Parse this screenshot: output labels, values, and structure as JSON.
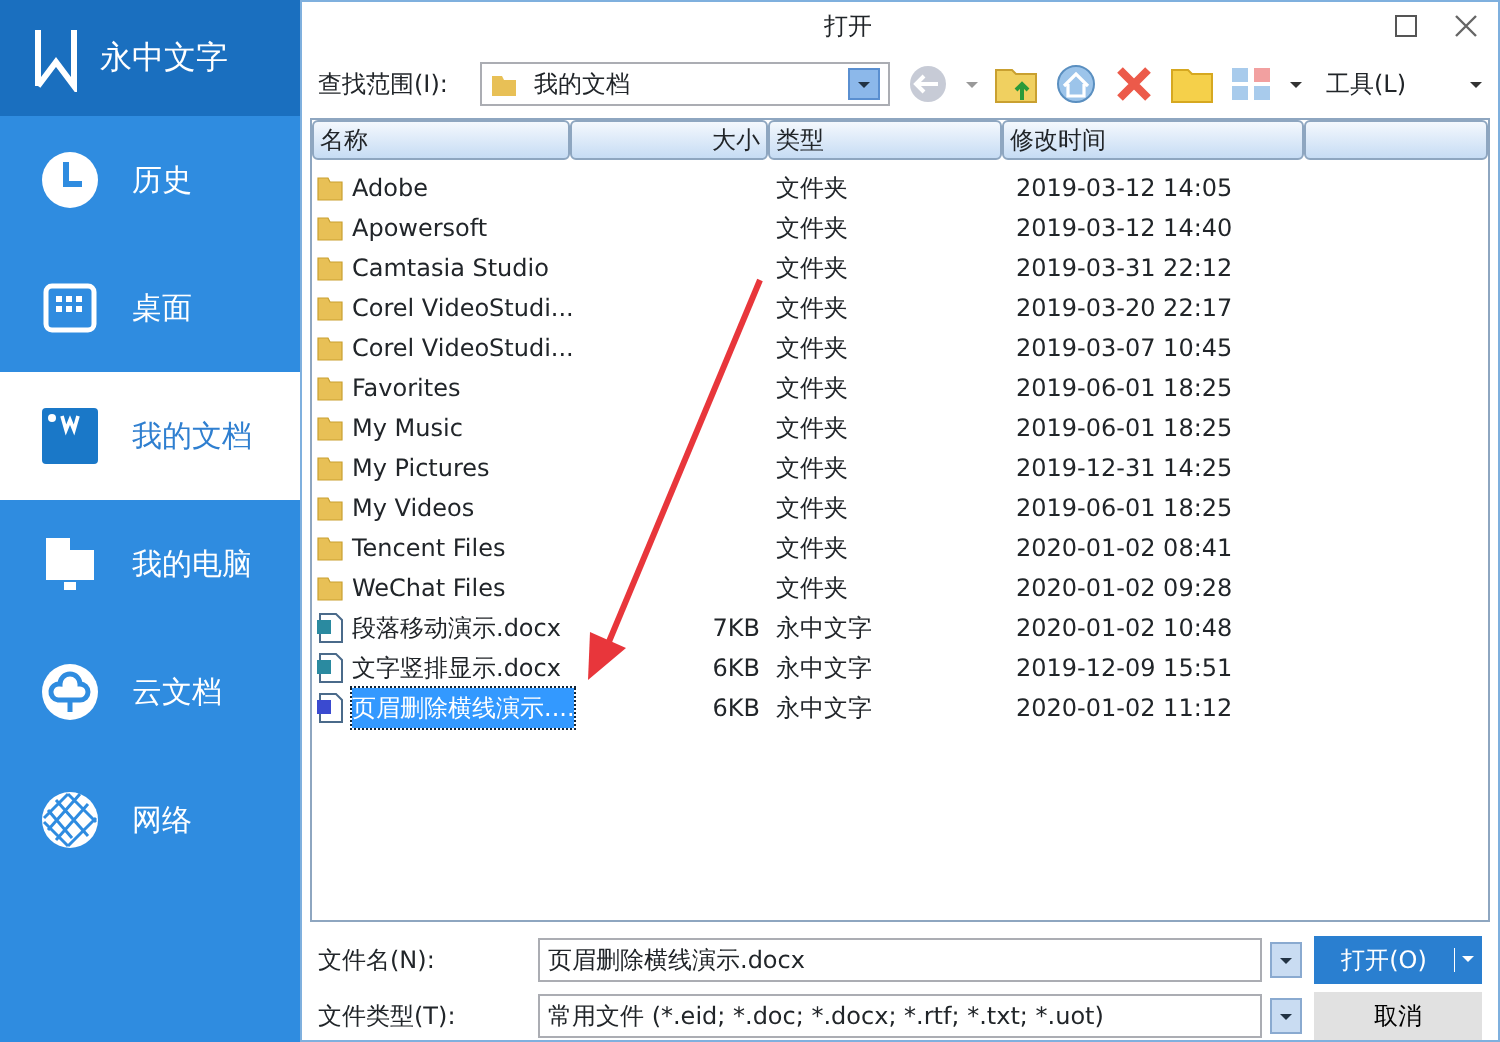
{
  "sidebar": {
    "app_name": "永中文字",
    "items": [
      {
        "kind": "history",
        "label": "历史",
        "selected": false
      },
      {
        "kind": "desktop",
        "label": "桌面",
        "selected": false
      },
      {
        "kind": "documents",
        "label": "我的文档",
        "selected": true
      },
      {
        "kind": "computer",
        "label": "我的电脑",
        "selected": false
      },
      {
        "kind": "cloud",
        "label": "云文档",
        "selected": false
      },
      {
        "kind": "network",
        "label": "网络",
        "selected": false
      }
    ]
  },
  "dialog": {
    "title": "打开",
    "look_in": {
      "label": "查找范围(I):",
      "value": "我的文档"
    },
    "tools": "工具(L)",
    "columns": [
      "名称",
      "大小",
      "类型",
      "修改时间"
    ],
    "files": [
      {
        "kind": "folder",
        "name": "Adobe",
        "type": "文件夹",
        "modified": "2019-03-12 14:05",
        "selected": false
      },
      {
        "kind": "folder",
        "name": "Apowersoft",
        "type": "文件夹",
        "modified": "2019-03-12 14:40",
        "selected": false
      },
      {
        "kind": "folder",
        "name": "Camtasia Studio",
        "type": "文件夹",
        "modified": "2019-03-31 22:12",
        "selected": false
      },
      {
        "kind": "folder",
        "name": "Corel VideoStudi...",
        "type": "文件夹",
        "modified": "2019-03-20 22:17",
        "selected": false
      },
      {
        "kind": "folder",
        "name": "Corel VideoStudi...",
        "type": "文件夹",
        "modified": "2019-03-07 10:45",
        "selected": false
      },
      {
        "kind": "folder",
        "name": "Favorites",
        "type": "文件夹",
        "modified": "2019-06-01 18:25",
        "selected": false
      },
      {
        "kind": "folder",
        "name": "My Music",
        "type": "文件夹",
        "modified": "2019-06-01 18:25",
        "selected": false
      },
      {
        "kind": "folder",
        "name": "My Pictures",
        "type": "文件夹",
        "modified": "2019-12-31 14:25",
        "selected": false
      },
      {
        "kind": "folder",
        "name": "My Videos",
        "type": "文件夹",
        "modified": "2019-06-01 18:25",
        "selected": false
      },
      {
        "kind": "folder",
        "name": "Tencent Files",
        "type": "文件夹",
        "modified": "2020-01-02 08:41",
        "selected": false
      },
      {
        "kind": "folder",
        "name": "WeChat Files",
        "type": "文件夹",
        "modified": "2020-01-02 09:28",
        "selected": false
      },
      {
        "kind": "document",
        "name": "段落移动演示.docx",
        "size": "7KB",
        "type": "永中文字",
        "modified": "2020-01-02 10:48",
        "selected": false
      },
      {
        "kind": "document",
        "name": "文字竖排显示.docx",
        "size": "6KB",
        "type": "永中文字",
        "modified": "2019-12-09 15:51",
        "selected": false
      },
      {
        "kind": "document",
        "name": "页眉删除横线演示....",
        "size": "6KB",
        "type": "永中文字",
        "modified": "2020-01-02 11:12",
        "selected": true
      }
    ],
    "file_name": {
      "label": "文件名(N):",
      "value": "页眉删除横线演示.docx"
    },
    "file_type": {
      "label": "文件类型(T):",
      "value": "常用文件 (*.eid; *.doc; *.docx; *.rtf; *.txt; *.uot)"
    },
    "open_button": "打开(O)",
    "cancel_button": "取消"
  }
}
